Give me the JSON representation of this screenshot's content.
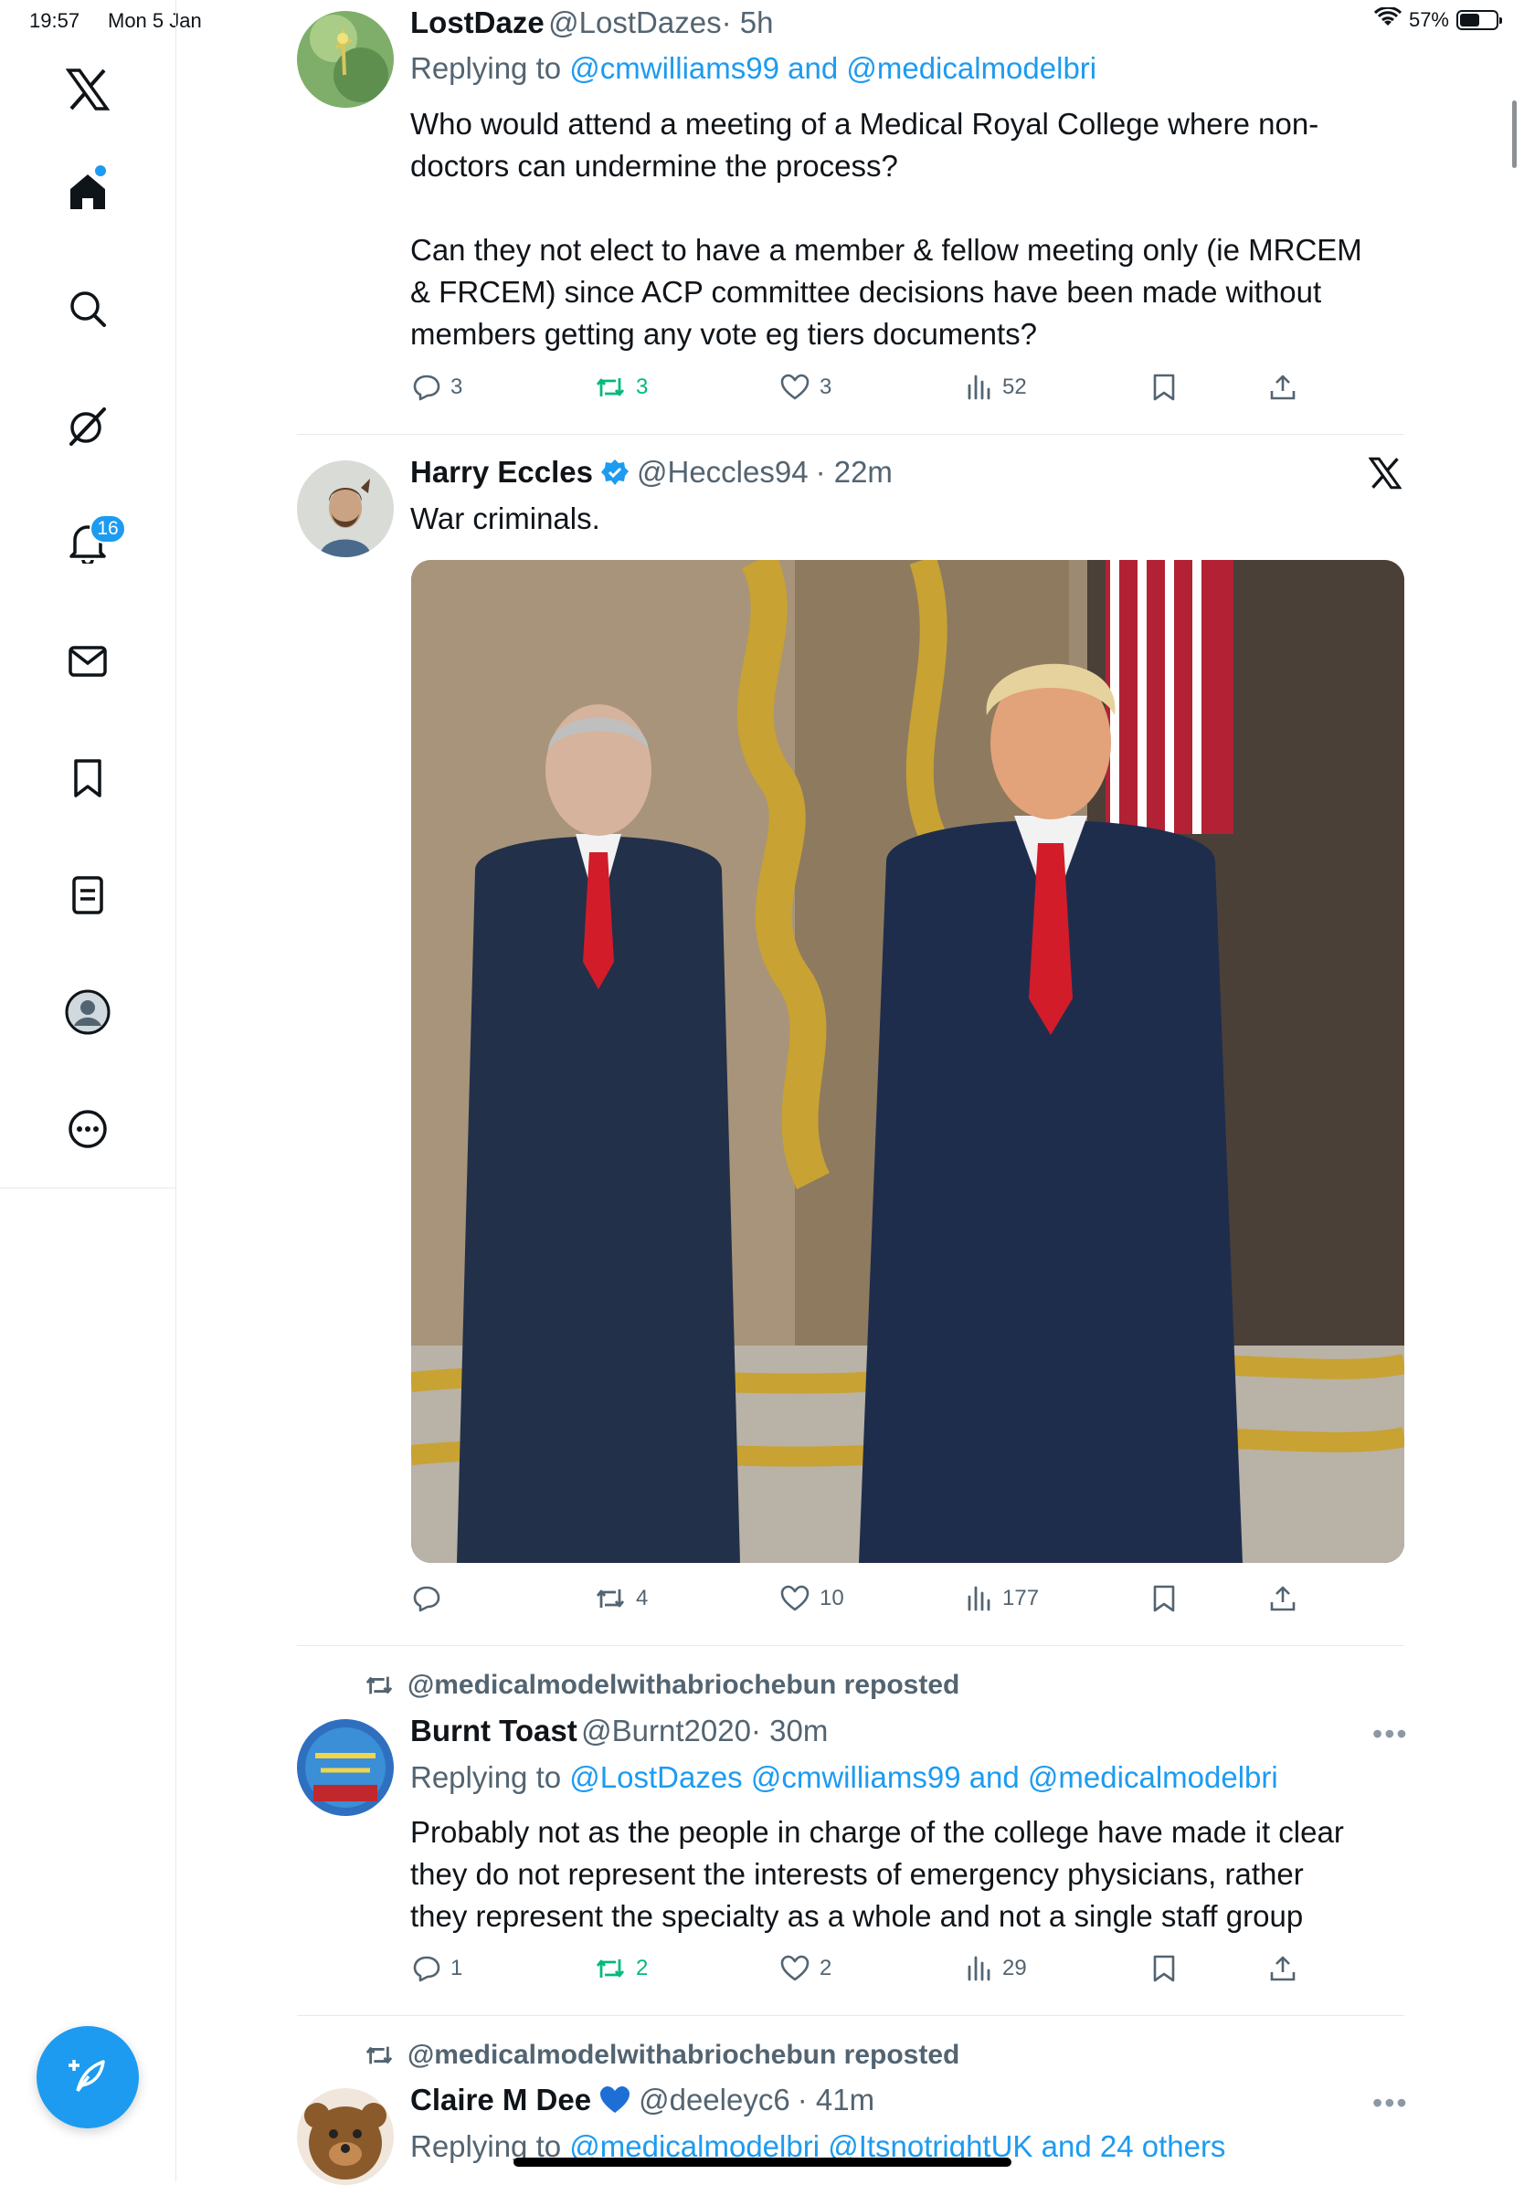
{
  "status_bar": {
    "time": "19:57",
    "date": "Mon 5 Jan",
    "battery": "57%",
    "battery_level": 0.57
  },
  "sidebar": {
    "items": [
      {
        "name": "x-logo-icon"
      },
      {
        "name": "home-icon"
      },
      {
        "name": "search-icon"
      },
      {
        "name": "grok-icon"
      },
      {
        "name": "notifications-icon",
        "badge": "16"
      },
      {
        "name": "messages-icon"
      },
      {
        "name": "bookmarks-icon"
      },
      {
        "name": "lists-icon"
      },
      {
        "name": "profile-icon"
      },
      {
        "name": "more-icon"
      }
    ]
  },
  "tweets": [
    {
      "name": "LostDaze",
      "handle": "@LostDazes",
      "time": "· 5h",
      "reply_prefix": "Replying to ",
      "reply_targets": "@cmwilliams99 and @medicalmodelbri",
      "text_lines": [
        "Who would attend a meeting of a Medical Royal College where non-",
        "doctors can undermine the process?",
        "",
        "Can they not elect to have a member & fellow meeting only (ie MRCEM",
        "& FRCEM) since ACP committee decisions have been made without",
        "members getting any vote eg tiers documents?"
      ],
      "replies": "3",
      "reposts": "3",
      "likes": "3",
      "views": "52"
    },
    {
      "name": "Harry Eccles",
      "handle": "@Heccles94",
      "time": "· 22m",
      "text": "War criminals.",
      "replies": "",
      "reposts": "4",
      "likes": "10",
      "views": "177"
    },
    {
      "repost_label": "@medicalmodelwithabriochebun reposted",
      "name": "Burnt Toast",
      "handle": "@Burnt2020",
      "time": "· 30m",
      "reply_prefix": "Replying to ",
      "reply_targets": "@LostDazes @cmwilliams99 and @medicalmodelbri",
      "text_lines": [
        "Probably not as the people in charge of the college have made it clear",
        "they do not represent the interests of emergency physicians, rather",
        "they represent the specialty as a whole and not a single staff group"
      ],
      "replies": "1",
      "reposts": "2",
      "likes": "2",
      "views": "29"
    },
    {
      "repost_label": "@medicalmodelwithabriochebun reposted",
      "name": "Claire M Dee",
      "handle": "@deeleyc6",
      "time": "· 41m",
      "reply_prefix": "Replying to ",
      "reply_targets": "@medicalmodelbri @ItsnotrightUK and 24 others"
    }
  ],
  "colors": {
    "accent": "#1d9bf0",
    "repost_green": "#00ba7c",
    "muted": "#536471"
  }
}
